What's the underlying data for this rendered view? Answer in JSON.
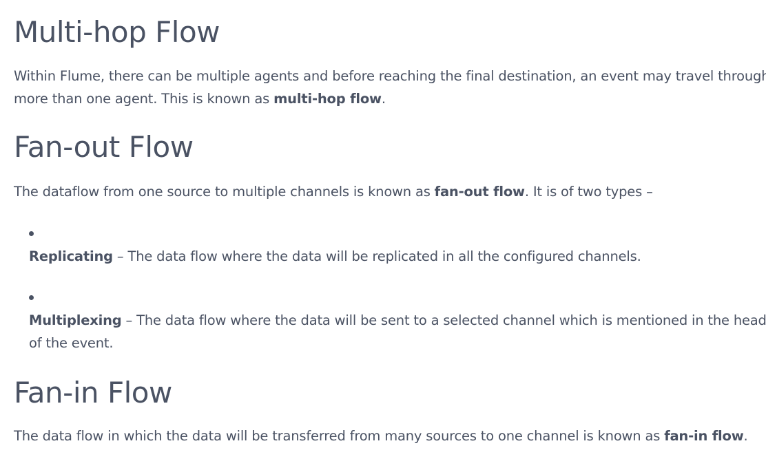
{
  "sections": [
    {
      "title": "Multi-hop Flow",
      "lines": [
        {
          "pre": "Within Flume, there can be multiple agents and before reaching the final destination, an event may travel through"
        },
        {
          "pre": "more than one agent. This is known as ",
          "bold": "multi-hop flow",
          "post": "."
        }
      ]
    },
    {
      "title": "Fan-out Flow",
      "lines": [
        {
          "pre": "The dataflow from one source to multiple channels is known as ",
          "bold": "fan-out flow",
          "post": ". It is of two types –"
        }
      ],
      "bullets": [
        {
          "bold": "Replicating",
          "text": " – The data flow where the data will be replicated in all the configured channels."
        },
        {
          "bold": "Multiplexing",
          "text": " – The data flow where the data will be sent to a selected channel which is mentioned in the header",
          "cont": "of the event."
        }
      ]
    },
    {
      "title": "Fan-in Flow",
      "lines": [
        {
          "pre": "The data flow in which the data will be transferred from many sources to one channel is known as ",
          "bold": "fan-in flow",
          "post": "."
        }
      ]
    }
  ],
  "colors": {
    "text": "#4a5263",
    "background": "#ffffff"
  }
}
